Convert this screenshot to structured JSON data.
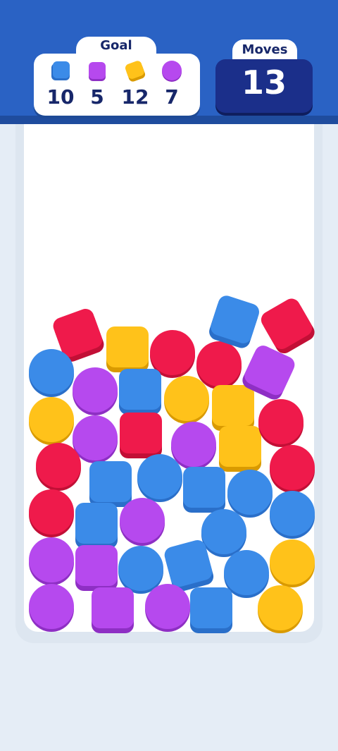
{
  "goal": {
    "title": "Goal",
    "items": [
      {
        "icon": "blue-cube-icon",
        "color": "#3b8be8",
        "shape": "square",
        "count": "10"
      },
      {
        "icon": "purple-cube-icon",
        "color": "#b649ee",
        "shape": "square",
        "count": "5"
      },
      {
        "icon": "yellow-cube-icon",
        "color": "#ffc21a",
        "shape": "square-tilted",
        "count": "12"
      },
      {
        "icon": "purple-ball-icon",
        "color": "#b649ee",
        "shape": "circle",
        "count": "7"
      }
    ]
  },
  "moves": {
    "title": "Moves",
    "value": "13"
  },
  "colors": {
    "red": "#ef1a4b",
    "blue": "#3b8be8",
    "yellow": "#ffc21a",
    "purple": "#b649ee",
    "header": "#2a62c4",
    "moves_box": "#1b2f8a",
    "text_dark": "#17276a"
  },
  "board": {
    "pieces": [
      {
        "color": "red",
        "shape": "cube"
      },
      {
        "color": "yellow",
        "shape": "cube"
      },
      {
        "color": "red",
        "shape": "ball"
      },
      {
        "color": "red",
        "shape": "ball"
      },
      {
        "color": "blue",
        "shape": "cube"
      },
      {
        "color": "red",
        "shape": "cube"
      },
      {
        "color": "blue",
        "shape": "ball"
      },
      {
        "color": "purple",
        "shape": "ball"
      },
      {
        "color": "blue",
        "shape": "cube"
      },
      {
        "color": "yellow",
        "shape": "ball"
      },
      {
        "color": "yellow",
        "shape": "cube"
      },
      {
        "color": "purple",
        "shape": "cube"
      },
      {
        "color": "yellow",
        "shape": "ball"
      },
      {
        "color": "purple",
        "shape": "ball"
      },
      {
        "color": "red",
        "shape": "cube"
      },
      {
        "color": "purple",
        "shape": "ball"
      },
      {
        "color": "yellow",
        "shape": "cube"
      },
      {
        "color": "red",
        "shape": "ball"
      },
      {
        "color": "red",
        "shape": "ball"
      },
      {
        "color": "blue",
        "shape": "cube"
      },
      {
        "color": "blue",
        "shape": "ball"
      },
      {
        "color": "blue",
        "shape": "cube"
      },
      {
        "color": "blue",
        "shape": "ball"
      },
      {
        "color": "red",
        "shape": "ball"
      },
      {
        "color": "red",
        "shape": "ball"
      },
      {
        "color": "blue",
        "shape": "cube"
      },
      {
        "color": "purple",
        "shape": "ball"
      },
      {
        "color": "blue",
        "shape": "ball"
      },
      {
        "color": "blue",
        "shape": "ball"
      },
      {
        "color": "purple",
        "shape": "ball"
      },
      {
        "color": "purple",
        "shape": "cube"
      },
      {
        "color": "blue",
        "shape": "ball"
      },
      {
        "color": "blue",
        "shape": "cube"
      },
      {
        "color": "blue",
        "shape": "ball"
      },
      {
        "color": "yellow",
        "shape": "ball"
      },
      {
        "color": "purple",
        "shape": "ball"
      },
      {
        "color": "purple",
        "shape": "cube"
      },
      {
        "color": "purple",
        "shape": "ball"
      },
      {
        "color": "blue",
        "shape": "cube"
      },
      {
        "color": "yellow",
        "shape": "ball"
      }
    ]
  }
}
